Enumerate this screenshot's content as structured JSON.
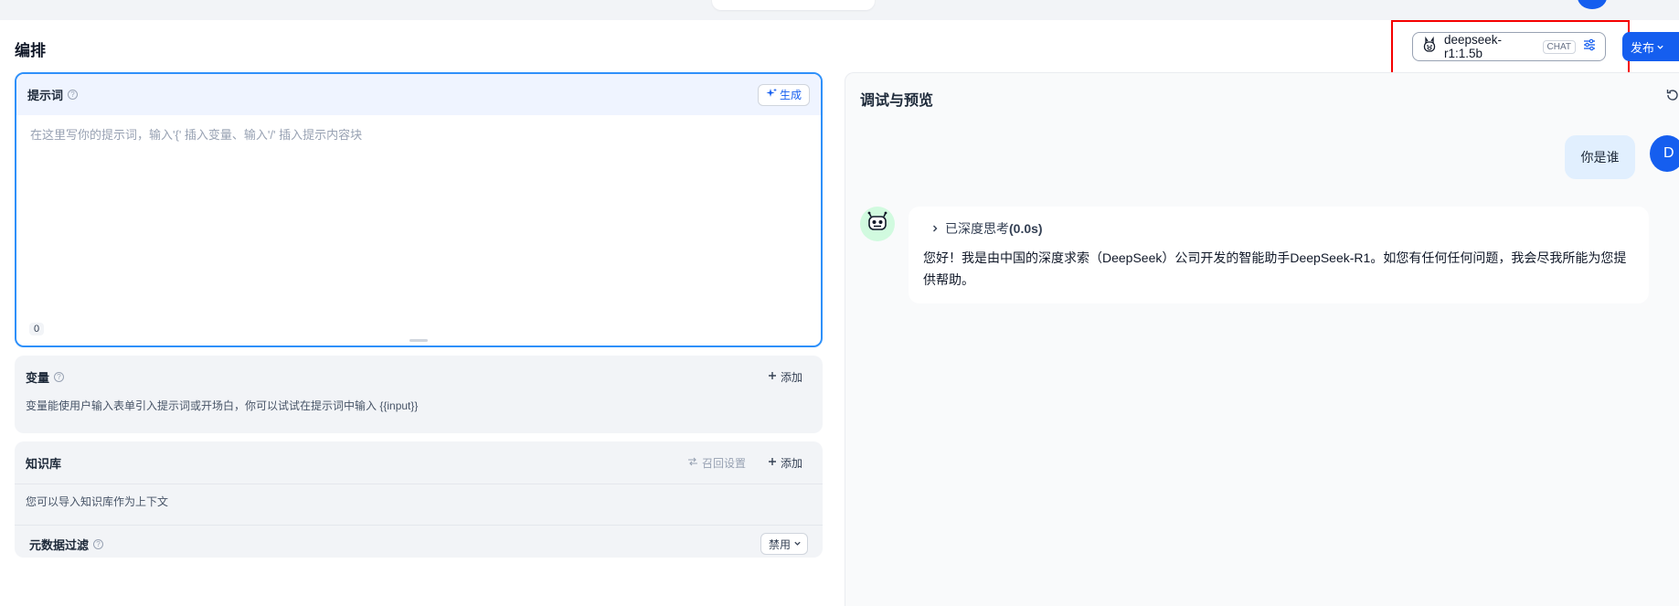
{
  "top_nav": {
    "tabs": [
      "",
      "",
      "",
      ""
    ],
    "right_item": ""
  },
  "page": {
    "title": "编排"
  },
  "model_selector": {
    "name": "deepseek-r1:1.5b",
    "badge": "CHAT"
  },
  "publish": {
    "label": "发布"
  },
  "prompt": {
    "label": "提示词",
    "generate_label": "生成",
    "placeholder": "在这里写你的提示词，输入'{' 插入变量、输入'/' 插入提示内容块",
    "char_count": "0"
  },
  "variables": {
    "label": "变量",
    "add_label": "添加",
    "description": "变量能使用户输入表单引入提示词或开场白，你可以试试在提示词中输入 {{input}}"
  },
  "knowledge": {
    "label": "知识库",
    "recall_label": "召回设置",
    "add_label": "添加",
    "description": "您可以导入知识库作为上下文",
    "metadata_filter_label": "元数据过滤",
    "metadata_filter_value": "禁用"
  },
  "preview": {
    "title": "调试与预览",
    "user_message": "你是谁",
    "user_initial": "D",
    "thinking_prefix": "已深度思考",
    "thinking_time": "(0.0s)",
    "answer": "您好！我是由中国的深度求索（DeepSeek）公司开发的智能助手DeepSeek-R1。如您有任何任何问题，我会尽我所能为您提供帮助。"
  },
  "colors": {
    "primary": "#155eef",
    "highlight_box": "#f50000",
    "focus_border": "#2e90fa"
  }
}
